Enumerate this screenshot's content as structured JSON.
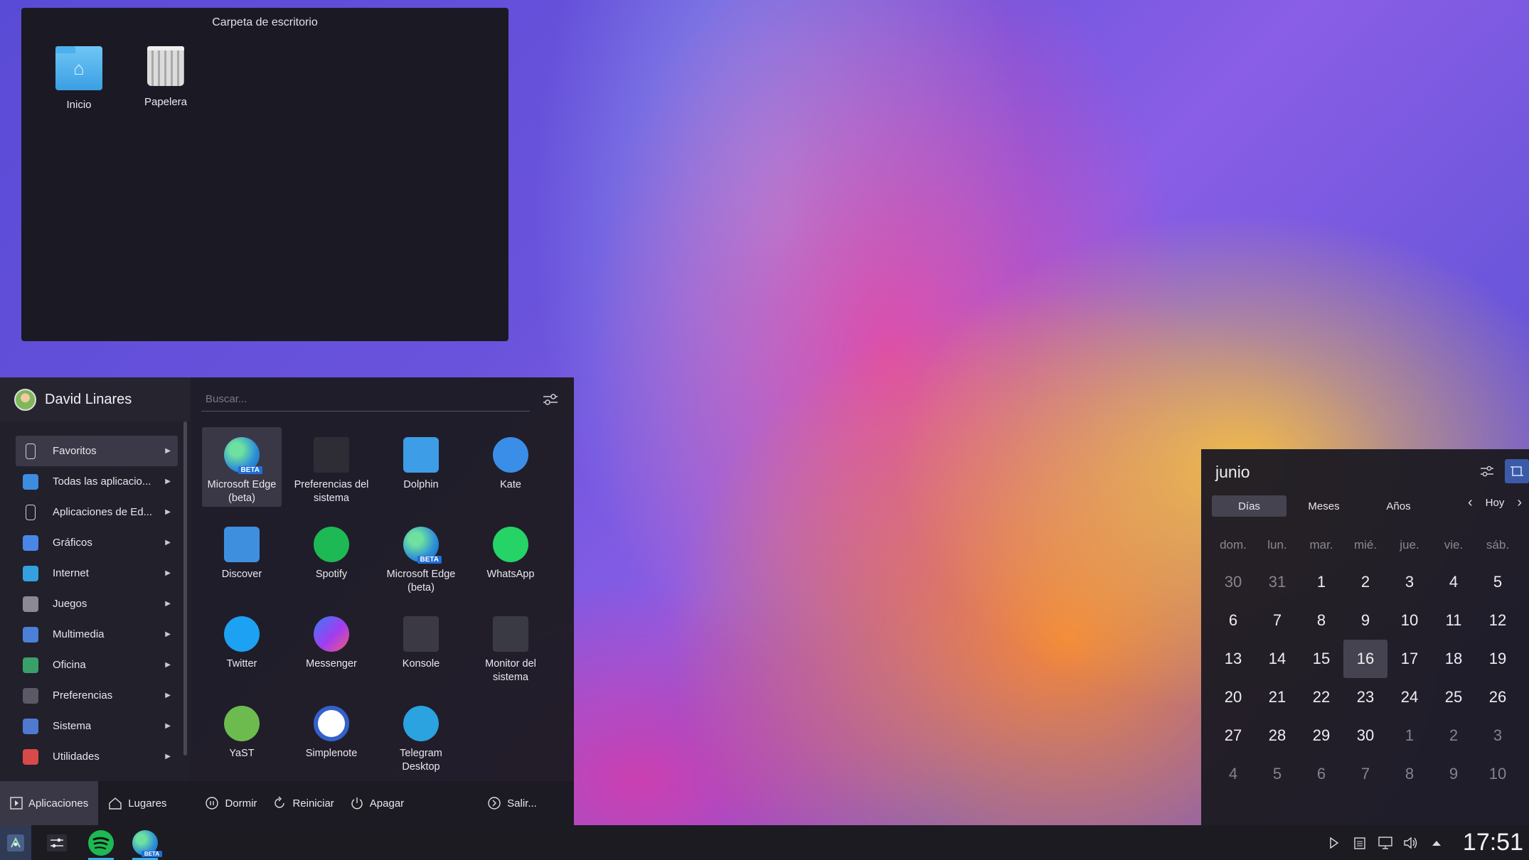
{
  "desktop": {
    "folder_widget": {
      "title": "Carpeta de escritorio",
      "icons": [
        {
          "label": "Inicio",
          "icon": "home-folder-icon"
        },
        {
          "label": "Papelera",
          "icon": "trash-icon"
        }
      ]
    }
  },
  "launcher": {
    "user_name": "David Linares",
    "search_placeholder": "Buscar...",
    "categories": [
      {
        "label": "Favoritos",
        "color": "#2a2834",
        "active": true
      },
      {
        "label": "Todas las aplicacio...",
        "color": "#3d8ce0"
      },
      {
        "label": "Aplicaciones de Ed...",
        "color": "#2a2834"
      },
      {
        "label": "Gráficos",
        "color": "#4a86e8"
      },
      {
        "label": "Internet",
        "color": "#35a0e0"
      },
      {
        "label": "Juegos",
        "color": "#8a8a96"
      },
      {
        "label": "Multimedia",
        "color": "#4c7fd8"
      },
      {
        "label": "Oficina",
        "color": "#3aa06a"
      },
      {
        "label": "Preferencias",
        "color": "#5a5a66"
      },
      {
        "label": "Sistema",
        "color": "#4f7ad0"
      },
      {
        "label": "Utilidades",
        "color": "#d84a4a"
      }
    ],
    "apps": [
      {
        "label": "Microsoft Edge (beta)",
        "icon": "edge-beta-icon",
        "color": "#2d8fd8",
        "beta": "BETA",
        "selected": true
      },
      {
        "label": "Preferencias del sistema",
        "icon": "system-settings-icon",
        "color": "#2e2d36"
      },
      {
        "label": "Dolphin",
        "icon": "dolphin-folder-icon",
        "color": "#3d9de6"
      },
      {
        "label": "Kate",
        "icon": "kate-icon",
        "color": "#3a8ee8"
      },
      {
        "label": "Discover",
        "icon": "discover-bag-icon",
        "color": "#3f8fdf"
      },
      {
        "label": "Spotify",
        "icon": "spotify-icon",
        "color": "#1db954"
      },
      {
        "label": "Microsoft Edge (beta)",
        "icon": "edge-beta-icon",
        "color": "#2d8fd8",
        "beta": "BETA"
      },
      {
        "label": "WhatsApp",
        "icon": "whatsapp-icon",
        "color": "#25d366"
      },
      {
        "label": "Twitter",
        "icon": "twitter-icon",
        "color": "#1da1f2"
      },
      {
        "label": "Messenger",
        "icon": "messenger-icon",
        "color": "#a33cf0"
      },
      {
        "label": "Konsole",
        "icon": "konsole-icon",
        "color": "#3b3a44"
      },
      {
        "label": "Monitor del sistema",
        "icon": "system-monitor-icon",
        "color": "#3a3a44"
      },
      {
        "label": "YaST",
        "icon": "yast-icon",
        "color": "#6dbb4e"
      },
      {
        "label": "Simplenote",
        "icon": "simplenote-icon",
        "color": "#3361cc"
      },
      {
        "label": "Telegram Desktop",
        "icon": "telegram-icon",
        "color": "#2aa3e0"
      }
    ],
    "footer": {
      "tabs": [
        {
          "label": "Aplicaciones",
          "active": true
        },
        {
          "label": "Lugares"
        }
      ],
      "actions": {
        "sleep": "Dormir",
        "restart": "Reiniciar",
        "shutdown": "Apagar",
        "logout": "Salir..."
      }
    }
  },
  "calendar": {
    "month": "junio",
    "tabs": [
      "Días",
      "Meses",
      "Años"
    ],
    "today_label": "Hoy",
    "weekdays": [
      "dom.",
      "lun.",
      "mar.",
      "mié.",
      "jue.",
      "vie.",
      "sáb."
    ],
    "days": [
      [
        "30",
        "31",
        "1",
        "2",
        "3",
        "4",
        "5"
      ],
      [
        "6",
        "7",
        "8",
        "9",
        "10",
        "11",
        "12"
      ],
      [
        "13",
        "14",
        "15",
        "16",
        "17",
        "18",
        "19"
      ],
      [
        "20",
        "21",
        "22",
        "23",
        "24",
        "25",
        "26"
      ],
      [
        "27",
        "28",
        "29",
        "30",
        "1",
        "2",
        "3"
      ],
      [
        "4",
        "5",
        "6",
        "7",
        "8",
        "9",
        "10"
      ]
    ],
    "muted": [
      [
        0,
        0
      ],
      [
        0,
        1
      ],
      [
        4,
        4
      ],
      [
        4,
        5
      ],
      [
        4,
        6
      ],
      [
        5,
        0
      ],
      [
        5,
        1
      ],
      [
        5,
        2
      ],
      [
        5,
        3
      ],
      [
        5,
        4
      ],
      [
        5,
        5
      ],
      [
        5,
        6
      ]
    ],
    "today": [
      2,
      3
    ]
  },
  "taskbar": {
    "apps": [
      {
        "icon": "system-settings-icon"
      },
      {
        "icon": "spotify-icon"
      },
      {
        "icon": "edge-beta-icon",
        "beta": "BETA"
      }
    ],
    "tray": [
      "play-icon",
      "clipboard-icon",
      "display-icon",
      "volume-icon",
      "expand-tray-icon"
    ],
    "clock": "17:51"
  }
}
